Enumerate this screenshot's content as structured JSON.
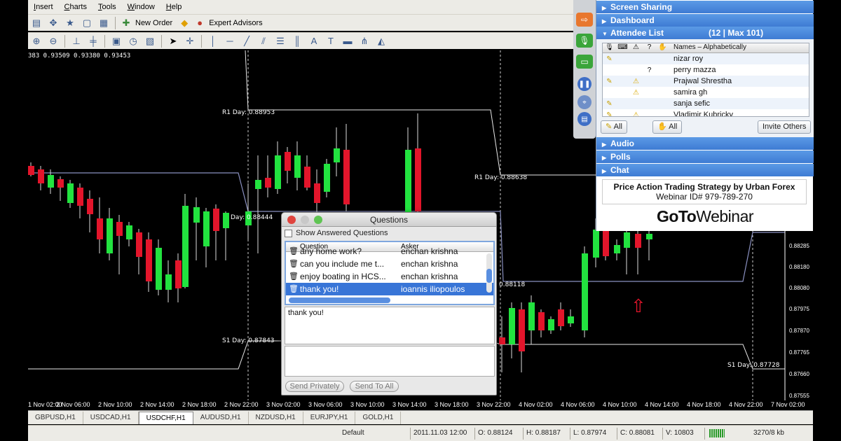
{
  "menubar": {
    "items": [
      "Insert",
      "Charts",
      "Tools",
      "Window",
      "Help"
    ]
  },
  "toolbar": {
    "new_order_label": "New Order",
    "expert_advisors_label": "Expert Advisors"
  },
  "chart": {
    "top_quote": "383 0.93509 0.93380 0.93453",
    "levels": {
      "r1_left": "R1 Day: 0.88953",
      "r1_right": "R1 Day: 0.88638",
      "pivot_left": "Day: 0.88444",
      "pivot_right": "0.88118",
      "s1_left": "S1 Day: 0.87843",
      "s1_right": "S1 Day: 0.87728"
    },
    "price_axis": [
      "0.88285",
      "0.88180",
      "0.88080",
      "0.87975",
      "0.87870",
      "0.87765",
      "0.87660",
      "0.87555"
    ],
    "time_axis": [
      "1 Nov 02:00",
      "2 Nov 06:00",
      "2 Nov 10:00",
      "2 Nov 14:00",
      "2 Nov 18:00",
      "2 Nov 22:00",
      "3 Nov 02:00",
      "3 Nov 06:00",
      "3 Nov 10:00",
      "3 Nov 14:00",
      "3 Nov 18:00",
      "3 Nov 22:00",
      "4 Nov 02:00",
      "4 Nov 06:00",
      "4 Nov 10:00",
      "4 Nov 14:00",
      "4 Nov 18:00",
      "4 Nov 22:00",
      "7 Nov 02:00"
    ],
    "colors": {
      "bull": "#22e33f",
      "bear": "#e3152b",
      "pivot_line": "#8a90c0",
      "sr_line": "#e8e8e8"
    }
  },
  "tabs": {
    "items": [
      "GBPUSD,H1",
      "USDCAD,H1",
      "USDCHF,H1",
      "AUDUSD,H1",
      "NZDUSD,H1",
      "EURJPY,H1",
      "GOLD,H1"
    ],
    "active": "USDCHF,H1"
  },
  "status": {
    "profile": "Default",
    "datetime": "2011.11.03 12:00",
    "open": "O: 0.88124",
    "high": "H: 0.88187",
    "low": "L: 0.87974",
    "close": "C: 0.88081",
    "volume": "V: 10803",
    "traffic": "3270/8 kb"
  },
  "panel": {
    "sections": {
      "screen_sharing": "Screen Sharing",
      "dashboard": "Dashboard",
      "attendee_list": "Attendee List",
      "attendee_count": "(12 | Max 101)",
      "audio": "Audio",
      "polls": "Polls",
      "chat": "Chat"
    },
    "attendee_header": "Names – Alphabetically",
    "attendees": [
      {
        "name": "nizar roy",
        "q": "",
        "warn": false,
        "pen": true
      },
      {
        "name": "perry mazza",
        "q": "?",
        "warn": false,
        "pen": false
      },
      {
        "name": "Prajwal Shrestha",
        "q": "",
        "warn": true,
        "pen": true
      },
      {
        "name": "samira gh",
        "q": "",
        "warn": true,
        "pen": false
      },
      {
        "name": "sanja sefic",
        "q": "",
        "warn": false,
        "pen": true
      },
      {
        "name": "Vladimir Kubricky",
        "q": "",
        "warn": true,
        "pen": true
      }
    ],
    "all_button_1": "All",
    "all_button_2": "All",
    "invite_button": "Invite Others",
    "webinar_title": "Price Action Trading Strategy by Urban Forex",
    "webinar_id": "Webinar ID# 979-789-270",
    "logo_goto": "GoTo",
    "logo_webinar": "Webinar"
  },
  "questions": {
    "title": "Questions",
    "show_answered_label": "Show Answered Questions",
    "col_question": "Question",
    "col_asker": "Asker",
    "rows": [
      {
        "question": "any home work?",
        "asker": "enchan krishna",
        "selected": false
      },
      {
        "question": "can you include me t...",
        "asker": "enchan krishna",
        "selected": false
      },
      {
        "question": "enjoy boating in HCS...",
        "asker": "enchan krishna",
        "selected": false
      },
      {
        "question": "thank you!",
        "asker": "ioannis iliopoulos",
        "selected": true
      }
    ],
    "answer_text": "thank you!",
    "send_privately": "Send Privately",
    "send_to_all": "Send To All"
  }
}
